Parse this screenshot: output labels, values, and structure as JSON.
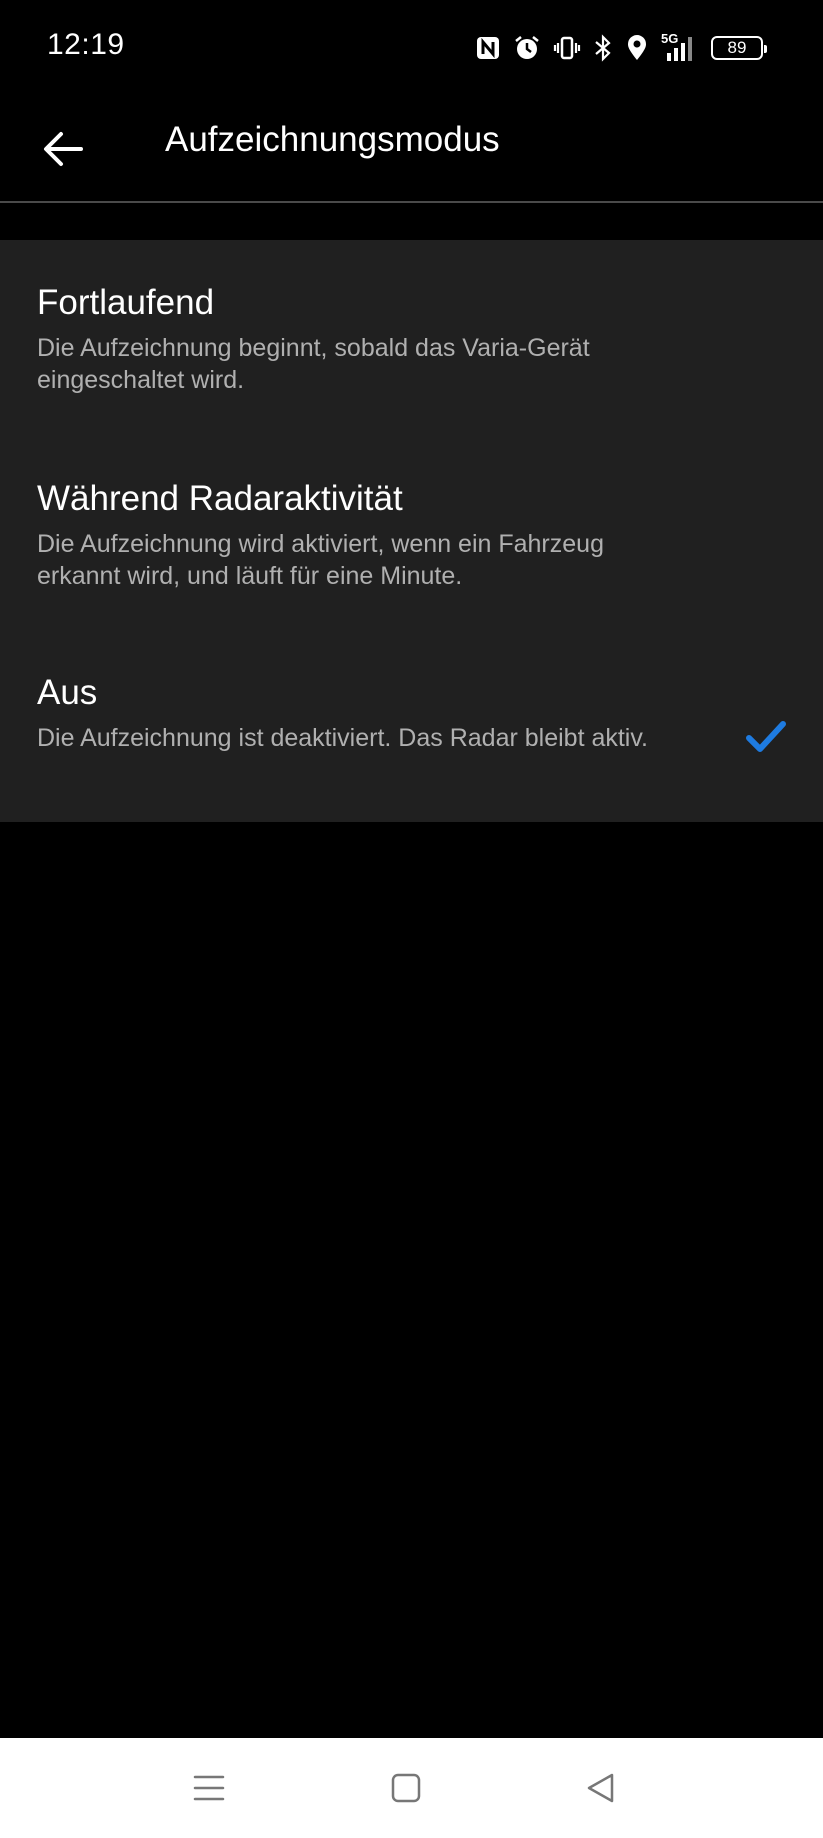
{
  "status_bar": {
    "time": "12:19",
    "icons": [
      "nfc-icon",
      "alarm-icon",
      "vibrate-icon",
      "bluetooth-icon",
      "location-icon",
      "5g-signal-icon"
    ],
    "network_label": "5G",
    "battery": "89"
  },
  "app_bar": {
    "back_icon": "arrow-left-icon",
    "title": "Aufzeichnungsmodus"
  },
  "options": [
    {
      "title": "Fortlaufend",
      "description": "Die Aufzeichnung beginnt, sobald das Varia-Gerät eingeschaltet wird.",
      "selected": false
    },
    {
      "title": "Während Radaraktivität",
      "description": "Die Aufzeichnung wird aktiviert, wenn ein Fahrzeug erkannt wird, und läuft für eine Minute.",
      "selected": false
    },
    {
      "title": "Aus",
      "description": "Die Aufzeichnung ist deaktiviert. Das Radar bleibt aktiv.",
      "selected": true
    }
  ],
  "nav_bar": {
    "buttons": [
      "menu-icon",
      "home-icon",
      "back-triangle-icon"
    ]
  },
  "colors": {
    "background": "#000000",
    "list_background": "#202020",
    "accent": "#1e7be0",
    "secondary_text": "#b0b0b0"
  }
}
